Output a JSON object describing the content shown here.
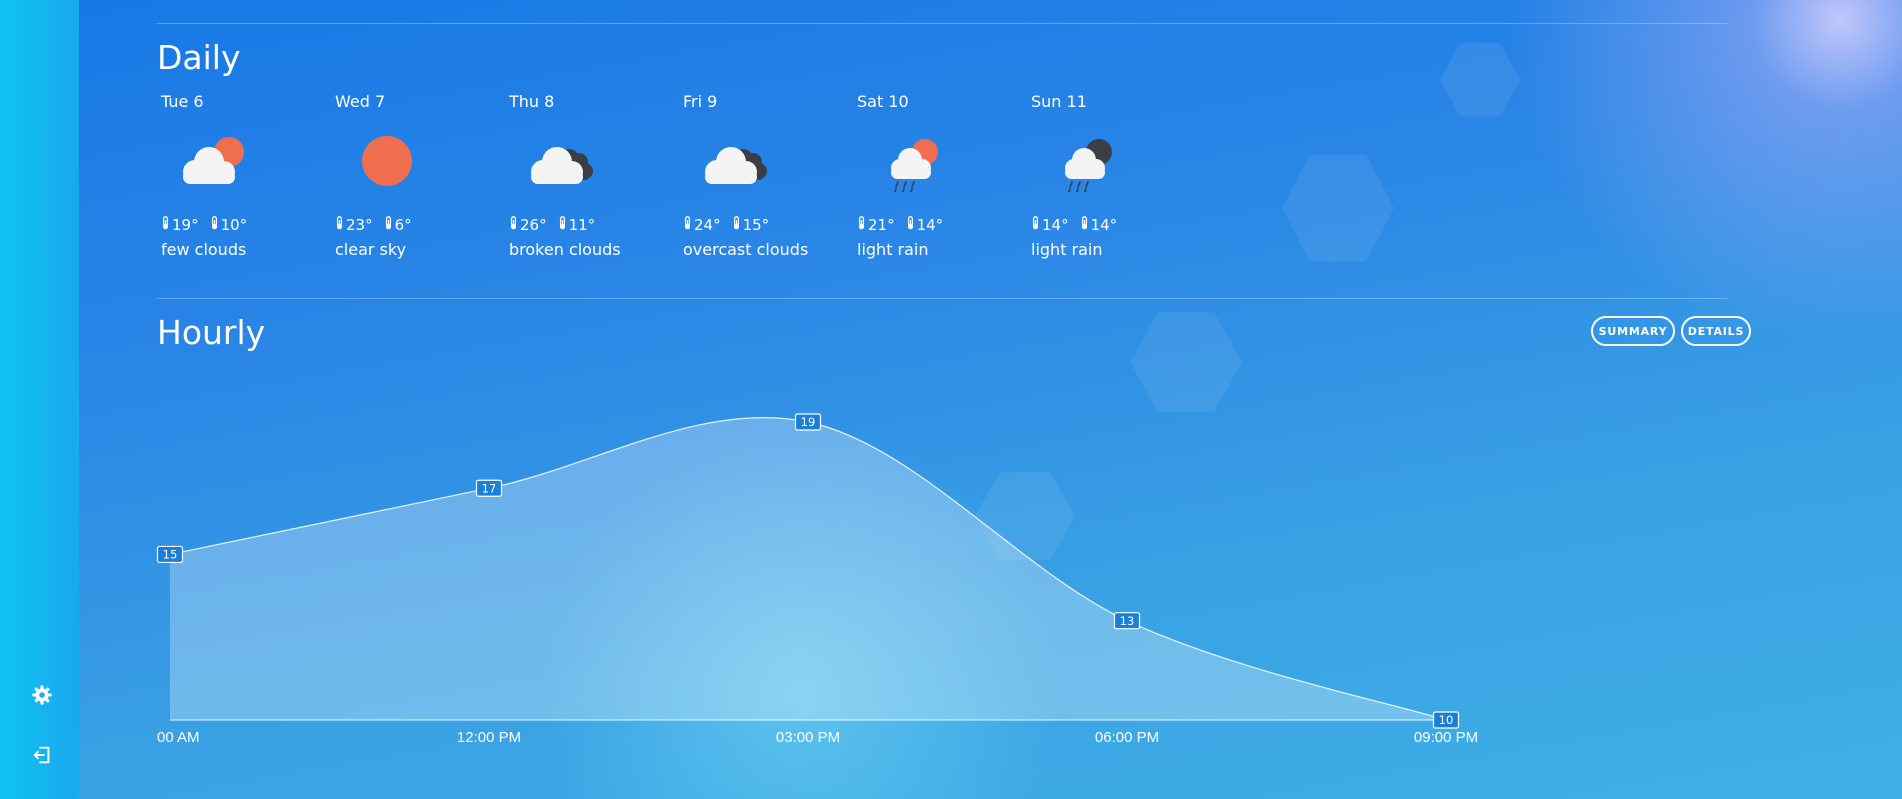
{
  "daily": {
    "title": "Daily",
    "days": [
      {
        "name": "Tue 6",
        "icon": "few-clouds-icon",
        "high": "19°",
        "low": "10°",
        "desc": "few clouds"
      },
      {
        "name": "Wed 7",
        "icon": "clear-sky-icon",
        "high": "23°",
        "low": "6°",
        "desc": "clear sky"
      },
      {
        "name": "Thu 8",
        "icon": "broken-clouds-icon",
        "high": "26°",
        "low": "11°",
        "desc": "broken clouds"
      },
      {
        "name": "Fri 9",
        "icon": "overcast-clouds-icon",
        "high": "24°",
        "low": "15°",
        "desc": "overcast clouds"
      },
      {
        "name": "Sat 10",
        "icon": "light-rain-day-icon",
        "high": "21°",
        "low": "14°",
        "desc": "light rain"
      },
      {
        "name": "Sun 11",
        "icon": "light-rain-night-icon",
        "high": "14°",
        "low": "14°",
        "desc": "light rain"
      }
    ]
  },
  "hourly": {
    "title": "Hourly",
    "summary_label": "SUMMARY",
    "details_label": "DETAILS"
  },
  "sidebar": {
    "icons": [
      "gear-icon",
      "logout-icon"
    ]
  },
  "colors": {
    "sun": "#ef6e4f",
    "cloud": "#f4f4f4",
    "dark_cloud": "#3b3f45",
    "accent": "#1a7fd6"
  },
  "chart_data": {
    "type": "area",
    "categories": [
      "00 AM",
      "12:00 PM",
      "03:00 PM",
      "06:00 PM",
      "09:00 PM"
    ],
    "values": [
      15,
      17,
      19,
      13,
      10
    ],
    "data_labels": [
      "15",
      "17",
      "19",
      "13",
      "10"
    ],
    "grid": false,
    "legend": "none"
  }
}
